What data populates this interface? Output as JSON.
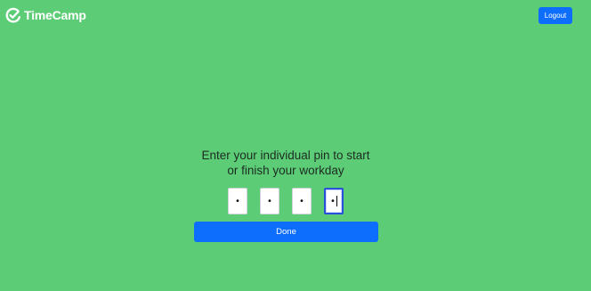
{
  "app": {
    "brand_name": "TimeCamp",
    "brand_icon": "timecamp-logo-icon"
  },
  "header": {
    "logout_label": "Logout"
  },
  "prompt": {
    "line1": "Enter your individual pin to start",
    "line2": "or finish your workday"
  },
  "pin": {
    "digits": [
      "•",
      "•",
      "•",
      "•"
    ],
    "focused_index": 3
  },
  "actions": {
    "done_label": "Done"
  },
  "colors": {
    "background": "#5ccd76",
    "primary_button": "#0d6efd",
    "focus_border": "#2a4fd9"
  }
}
